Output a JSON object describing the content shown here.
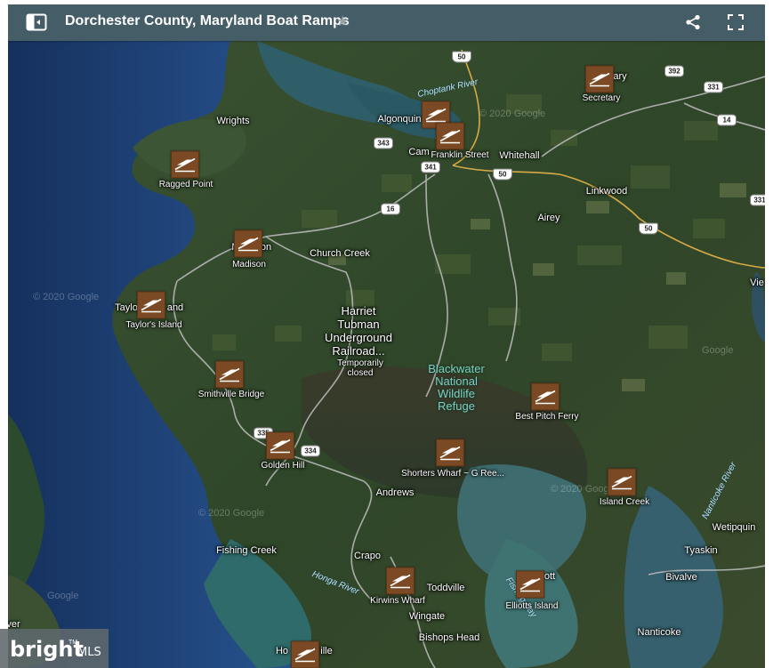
{
  "header": {
    "title": "Dorchester County, Maryland Boat Ramps",
    "star": "★",
    "icons": {
      "panel_toggle": "panel-toggle-icon",
      "share": "share-icon",
      "fullscreen": "fullscreen-icon"
    }
  },
  "markers": [
    {
      "id": "ragged-point",
      "label": "Ragged Point"
    },
    {
      "id": "madison",
      "label": "Madison"
    },
    {
      "id": "taylors-island",
      "label": "Taylor's Island"
    },
    {
      "id": "smithville-bridge",
      "label": "Smithville Bridge"
    },
    {
      "id": "golden-hill",
      "label": "Golden Hill"
    },
    {
      "id": "shorters-wharf",
      "label": "Shorters Wharf ~ G Ree..."
    },
    {
      "id": "best-pitch-ferry",
      "label": "Best Pitch Ferry"
    },
    {
      "id": "island-creek",
      "label": "Island Creek"
    },
    {
      "id": "kirwins-wharf",
      "label": "Kirwins Wharf"
    },
    {
      "id": "elliotts-island",
      "label": "Elliotts Island"
    },
    {
      "id": "secretary",
      "label": "Secretary"
    },
    {
      "id": "franklin-street",
      "label": "Franklin Street"
    },
    {
      "id": "algonquin",
      "label": ""
    },
    {
      "id": "hoopersville",
      "label": ""
    }
  ],
  "places": {
    "wrights": "Wrights",
    "algonquin": "Algonquin",
    "cambridge": "Cam",
    "whitehall": "Whitehall",
    "linkwood": "Linkwood",
    "airey": "Airey",
    "church_creek": "Church Creek",
    "taylors": "Taylo",
    "taylors_end": "and",
    "madison_town": "M",
    "madison_end": "on",
    "andrews": "Andrews",
    "fishing_creek": "Fishing Creek",
    "crapo": "Crapo",
    "toddville": "Toddville",
    "wingate": "Wingate",
    "bishops_head": "Bishops Head",
    "wetipquin": "Wetipquin",
    "tyaskin": "Tyaskin",
    "bivalve": "Bivalve",
    "nanticoke": "Nanticoke",
    "vienna": "Vie",
    "secretary_town": "ary",
    "hoopers_start": "Ho",
    "hoopers_end": "ille",
    "elliott": "ott",
    "edge_left": "ver"
  },
  "landmarks": {
    "harriet": "Harriet",
    "tubman": "Tubman",
    "underground": "Underground",
    "railroad": "Railroad...",
    "temp1": "Temporarily",
    "temp2": "closed",
    "blackwater1": "Blackwater",
    "blackwater2": "National",
    "blackwater3": "Wildlife",
    "blackwater4": "Refuge"
  },
  "water": {
    "choptank": "Choptank River",
    "honga": "Honga River",
    "fishing_bay": "Fishing Bay",
    "nanticoke_river": "Nanticoke River"
  },
  "roads": {
    "r50_top": "50",
    "r392": "392",
    "r331": "331",
    "r14": "14",
    "r343": "343",
    "r341": "341",
    "r50_mid": "50",
    "r16": "16",
    "r50_right": "50",
    "r331_edge": "331",
    "r335": "335",
    "r334": "334"
  },
  "watermarks": {
    "w1": "© 2020 Google",
    "w2": "© 2020 Google",
    "w3": "© 2020 Google",
    "w4": "Google",
    "w5": "© 2020 Google",
    "w6": "Google"
  },
  "logo": {
    "bright": "bright",
    "tm": "TM",
    "mls": "MLS"
  },
  "colors": {
    "header_bg": "#445d67",
    "marker_bg": "#7b4a24",
    "water_deep": "#1e4873",
    "land": "#33472c",
    "park_text": "#79d3c0"
  }
}
